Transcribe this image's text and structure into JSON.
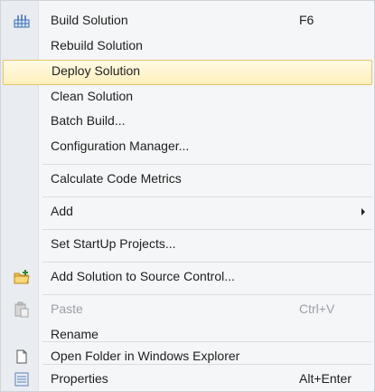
{
  "menu": {
    "items": [
      {
        "label": "Build Solution",
        "shortcut": "F6",
        "icon": "build-icon"
      },
      {
        "label": "Rebuild Solution"
      },
      {
        "label": "Deploy Solution"
      },
      {
        "label": "Clean Solution"
      },
      {
        "label": "Batch Build..."
      },
      {
        "label": "Configuration Manager..."
      },
      {
        "label": "Calculate Code Metrics"
      },
      {
        "label": "Add"
      },
      {
        "label": "Set StartUp Projects..."
      },
      {
        "label": "Add Solution to Source Control...",
        "icon": "folder-add-icon"
      },
      {
        "label": "Paste",
        "shortcut": "Ctrl+V",
        "icon": "paste-icon"
      },
      {
        "label": "Rename"
      },
      {
        "label": "Open Folder in Windows Explorer",
        "icon": "open-folder-icon"
      },
      {
        "label": "Properties",
        "shortcut": "Alt+Enter",
        "icon": "properties-icon"
      }
    ]
  },
  "colors": {
    "highlight_border": "#e5c365",
    "highlight_fill": "#ffefbd",
    "disabled_text": "#9aa0a6"
  }
}
